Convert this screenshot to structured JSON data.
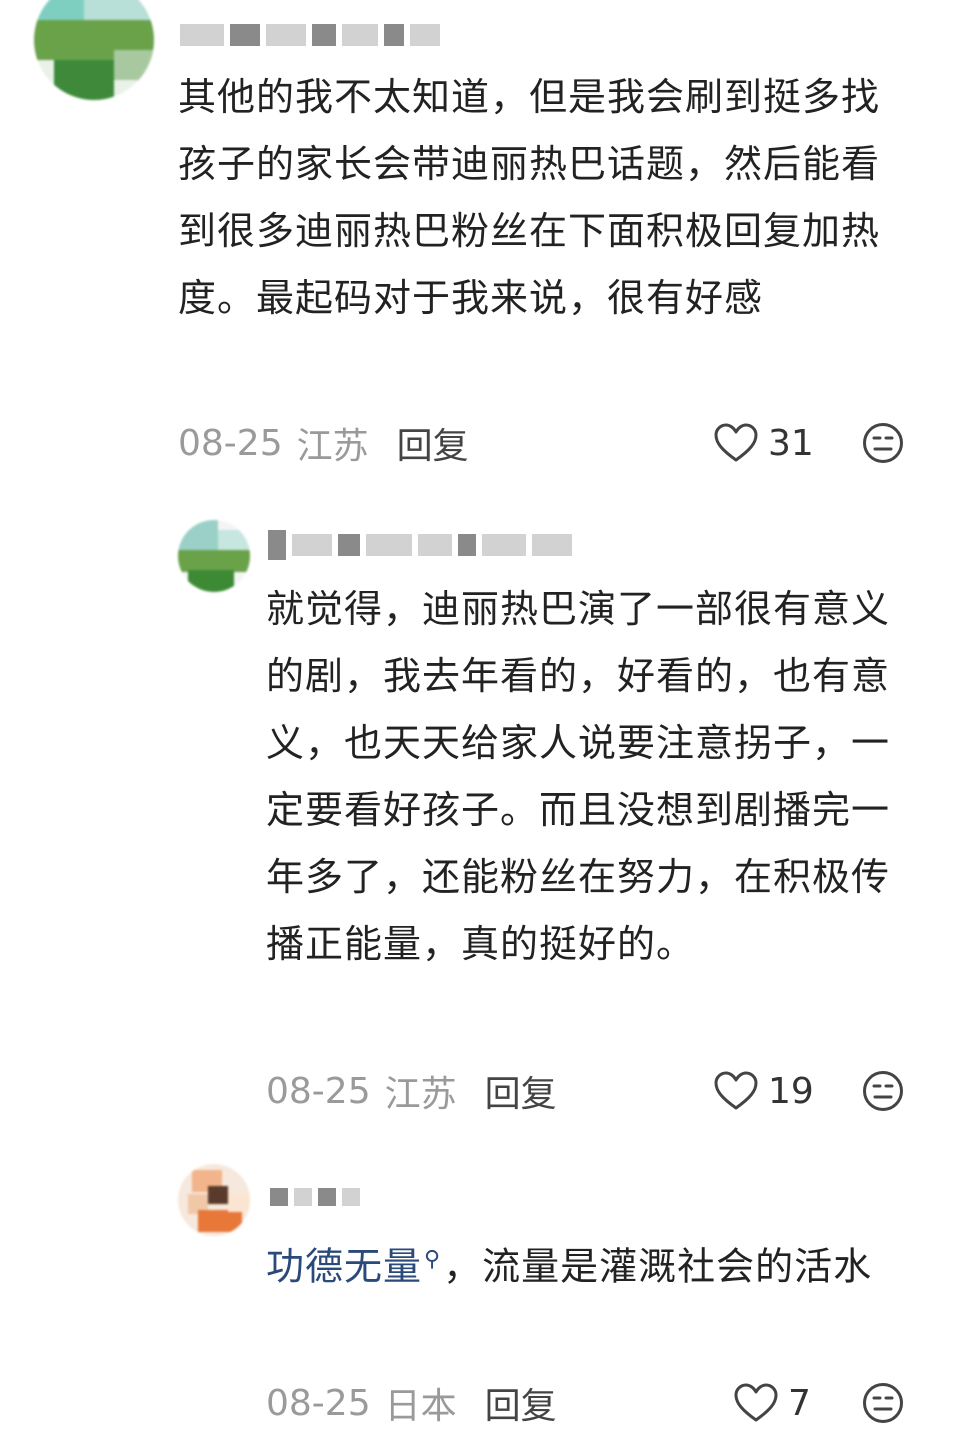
{
  "comments": [
    {
      "avatar": {
        "colors": [
          "#7fcfc0",
          "#3e8a3a",
          "#e9f1e9"
        ]
      },
      "text": "其他的我不太知道，但是我会刷到挺多找孩子的家长会带迪丽热巴话题，然后能看到很多迪丽热巴粉丝在下面积极回复加热度。最起码对于我来说，很有好感",
      "date": "08-25",
      "location": "江苏",
      "reply_label": "回复",
      "likes": "31",
      "icons": {
        "like": "heart-icon",
        "reaction": "emoji-icon"
      }
    },
    {
      "avatar": {
        "colors": [
          "#9ad0c8",
          "#3d8a35",
          "#f4f4f4"
        ]
      },
      "text": "就觉得，迪丽热巴演了一部很有意义的剧，我去年看的，好看的，也有意义，也天天给家人说要注意拐子，一定要看好孩子。而且没想到剧播完一年多了，还能粉丝在努力，在积极传播正能量，真的挺好的。",
      "date": "08-25",
      "location": "江苏",
      "reply_label": "回复",
      "likes": "19",
      "icons": {
        "like": "heart-icon",
        "reaction": "emoji-icon"
      }
    },
    {
      "avatar": {
        "colors": [
          "#e8773a",
          "#5a3a2a",
          "#f6e8dc"
        ]
      },
      "link_text": "功德无量",
      "text": "，流量是灌溉社会的活水",
      "date": "08-25",
      "location": "日本",
      "reply_label": "回复",
      "likes": "7",
      "icons": {
        "like": "heart-icon",
        "reaction": "emoji-icon",
        "link": "search-icon"
      }
    }
  ]
}
